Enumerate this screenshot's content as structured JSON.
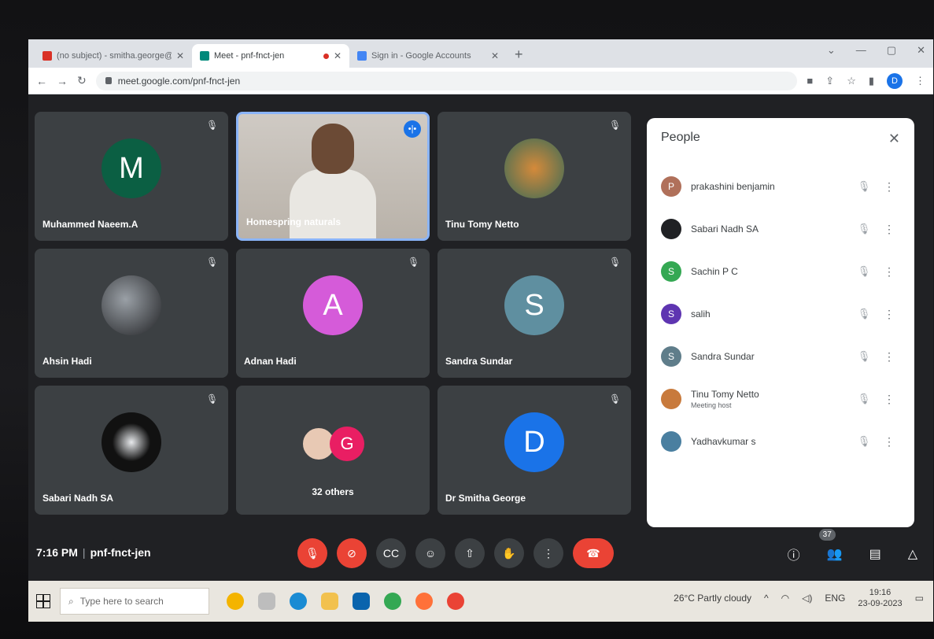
{
  "browser": {
    "tabs": [
      {
        "title": "(no subject) - smitha.george@",
        "fav_color": "#d93025"
      },
      {
        "title": "Meet - pnf-fnct-jen",
        "fav_color": "#00897b",
        "recording": true
      },
      {
        "title": "Sign in - Google Accounts",
        "fav_color": "#4285f4"
      }
    ],
    "url": "meet.google.com/pnf-fnct-jen",
    "profile_initial": "D"
  },
  "grid": {
    "tiles": [
      {
        "name": "Muhammed Naeem.A",
        "initial": "M",
        "color": "#0b5f43",
        "type": "avatar"
      },
      {
        "name": "Homespring naturals",
        "type": "video"
      },
      {
        "name": "Tinu Tomy Netto",
        "type": "photo"
      },
      {
        "name": "Ahsin Hadi",
        "type": "photo"
      },
      {
        "name": "Adnan Hadi",
        "initial": "A",
        "color": "#d55bd9",
        "type": "avatar"
      },
      {
        "name": "Sandra Sundar",
        "initial": "S",
        "color": "#5f8fa0",
        "type": "avatar"
      },
      {
        "name": "Sabari Nadh SA",
        "type": "photo"
      },
      {
        "name": "32 others",
        "initial": "G",
        "type": "group"
      },
      {
        "name": "Dr Smitha George",
        "initial": "D",
        "color": "#1a73e8",
        "type": "avatar"
      }
    ]
  },
  "footer": {
    "time": "7:16 PM",
    "meeting_code": "pnf-fnct-jen",
    "people_count": "37"
  },
  "people_panel": {
    "title": "People",
    "people": [
      {
        "name": "prakashini benjamin",
        "initial": "P",
        "color": "#b0705a"
      },
      {
        "name": "Sabari Nadh SA",
        "initial": "",
        "color": "#202124"
      },
      {
        "name": "Sachin P C",
        "initial": "S",
        "color": "#34a853"
      },
      {
        "name": "salih",
        "initial": "S",
        "color": "#5e35b1"
      },
      {
        "name": "Sandra Sundar",
        "initial": "S",
        "color": "#5f7d8a"
      },
      {
        "name": "Tinu Tomy Netto",
        "sub": "Meeting host",
        "initial": "",
        "color": "#c87a3c"
      },
      {
        "name": "Yadhavkumar s",
        "initial": "",
        "color": "#4a7fa0"
      }
    ]
  },
  "taskbar": {
    "search_placeholder": "Type here to search",
    "weather": "26°C  Partly cloudy",
    "lang": "ENG",
    "clock_time": "19:16",
    "clock_date": "23-09-2023"
  }
}
